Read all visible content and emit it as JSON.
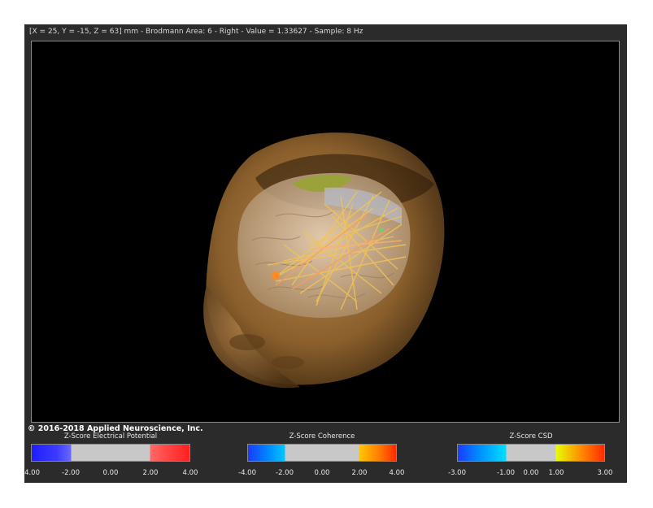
{
  "status_line": "[X = 25, Y = -15, Z = 63] mm - Brodmann Area: 6 - Right - Value = 1.33627 - Sample: 8 Hz",
  "copyright": "© 2016-2018 Applied Neuroscience, Inc.",
  "legends": [
    {
      "title": "Z-Score Electrical Potential",
      "ticks": [
        "-4.00",
        "-2.00",
        "0.00",
        "2.00",
        "4.00"
      ],
      "colors": [
        "#2222ff",
        "#5555ff",
        "#c8c8c8",
        "#ff6666",
        "#ff2222"
      ]
    },
    {
      "title": "Z-Score Coherence",
      "ticks": [
        "-4.00",
        "-2.00",
        "0.00",
        "2.00",
        "4.00"
      ],
      "colors": [
        "#1a3cff",
        "#00c8ff",
        "#c8c8c8",
        "#ffc800",
        "#ff2a00"
      ]
    },
    {
      "title": "Z-Score CSD",
      "ticks": [
        "-3.00",
        "-1.00",
        "0.00",
        "1.00",
        "3.00"
      ],
      "colors": [
        "#1a3cff",
        "#00e0ff",
        "#c8c8c8",
        "#e6ff00",
        "#ff2a00"
      ]
    }
  ]
}
